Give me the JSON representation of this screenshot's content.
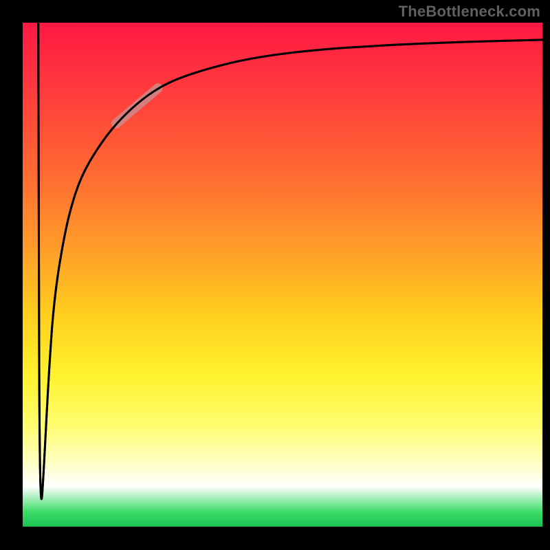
{
  "watermark": "TheBottleneck.com",
  "chart_data": {
    "type": "line",
    "title": "",
    "xlabel": "",
    "ylabel": "",
    "xlim": [
      0,
      100
    ],
    "ylim": [
      0,
      100
    ],
    "series": [
      {
        "name": "main-curve",
        "x": [
          3,
          3.1,
          3.2,
          3.5,
          4,
          5,
          6,
          8,
          10,
          12,
          15,
          18,
          22,
          26,
          30,
          36,
          44,
          55,
          70,
          85,
          100
        ],
        "y": [
          100,
          60,
          20,
          3,
          10,
          30,
          45,
          58,
          66,
          71,
          76,
          80,
          84,
          87,
          89,
          91,
          93,
          94.5,
          95.6,
          96.2,
          96.6
        ]
      },
      {
        "name": "highlight-segment",
        "x": [
          18,
          26
        ],
        "y": [
          80,
          87
        ]
      }
    ],
    "colors": {
      "curve": "#000000",
      "highlight": "#cc8a8a",
      "background_top": "#ff1844",
      "background_mid": "#fff22e",
      "background_bottom": "#19c24f",
      "frame": "#000000"
    }
  }
}
